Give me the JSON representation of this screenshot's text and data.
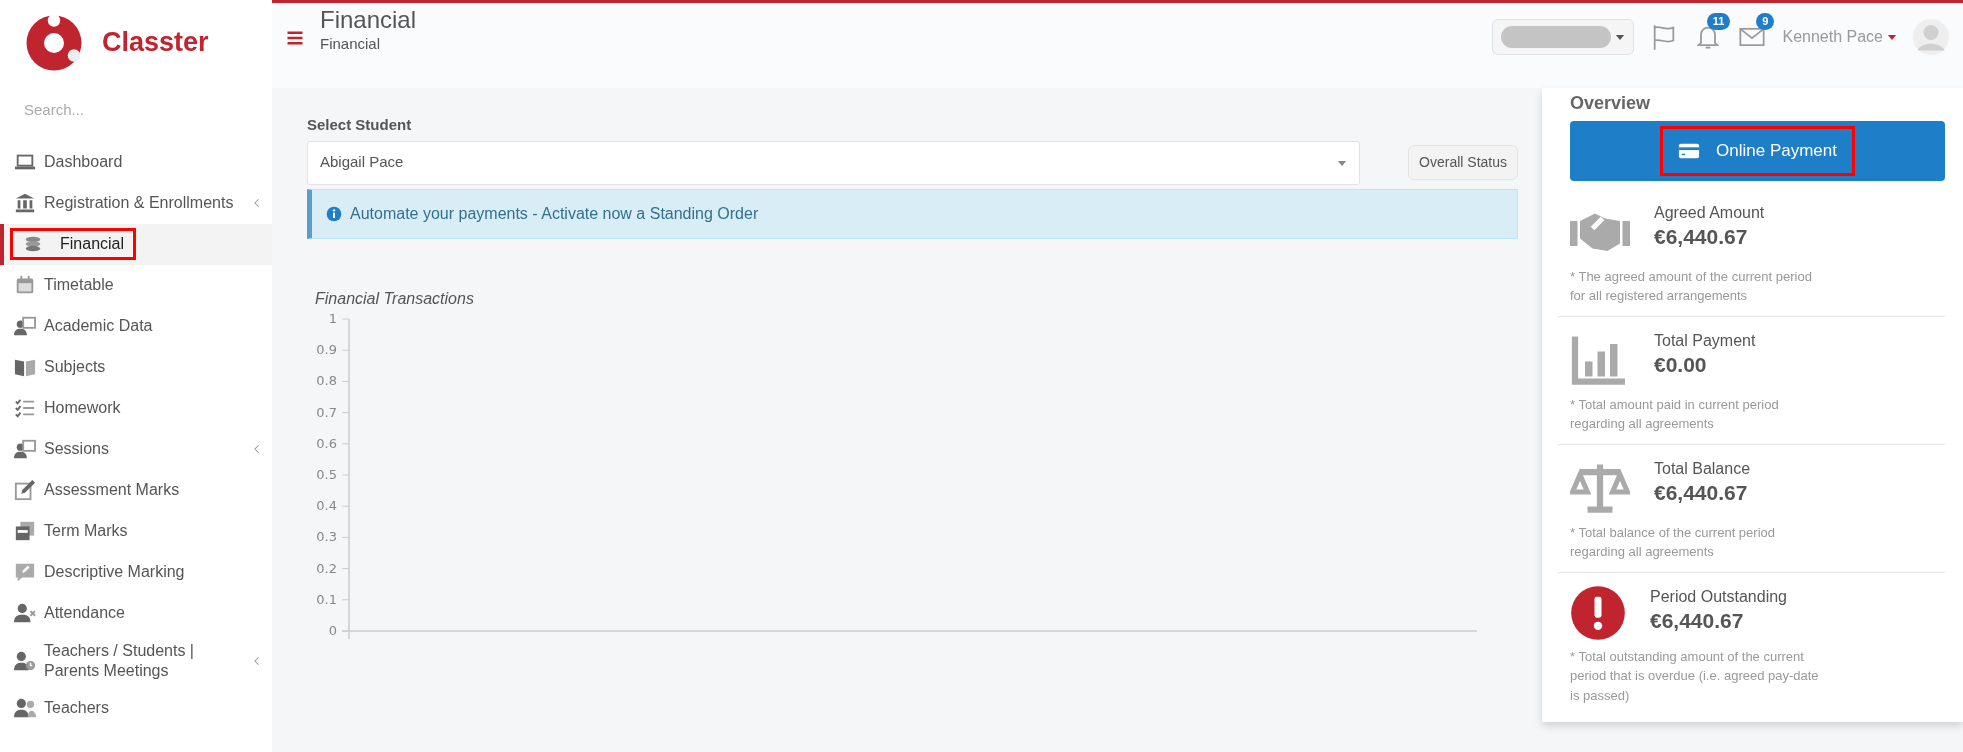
{
  "brand": {
    "name": "Classter"
  },
  "sidebar": {
    "search_placeholder": "Search...",
    "items": [
      {
        "label": "Dashboard",
        "selected": false,
        "has_submenu": false,
        "annotated": false
      },
      {
        "label": "Registration & Enrollments",
        "selected": false,
        "has_submenu": true,
        "annotated": false
      },
      {
        "label": "Financial",
        "selected": true,
        "has_submenu": false,
        "annotated": true
      },
      {
        "label": "Timetable",
        "selected": false,
        "has_submenu": false,
        "annotated": false
      },
      {
        "label": "Academic Data",
        "selected": false,
        "has_submenu": false,
        "annotated": false
      },
      {
        "label": "Subjects",
        "selected": false,
        "has_submenu": false,
        "annotated": false
      },
      {
        "label": "Homework",
        "selected": false,
        "has_submenu": false,
        "annotated": false
      },
      {
        "label": "Sessions",
        "selected": false,
        "has_submenu": true,
        "annotated": false
      },
      {
        "label": "Assessment Marks",
        "selected": false,
        "has_submenu": false,
        "annotated": false
      },
      {
        "label": "Term Marks",
        "selected": false,
        "has_submenu": false,
        "annotated": false
      },
      {
        "label": "Descriptive Marking",
        "selected": false,
        "has_submenu": false,
        "annotated": false
      },
      {
        "label": "Attendance",
        "selected": false,
        "has_submenu": false,
        "annotated": false
      },
      {
        "label": "Teachers / Students | Parents Meetings",
        "selected": false,
        "has_submenu": true,
        "annotated": false
      },
      {
        "label": "Teachers",
        "selected": false,
        "has_submenu": false,
        "annotated": false
      }
    ]
  },
  "header": {
    "title": "Financial",
    "subtitle": "Financial",
    "notifications_count": "11",
    "messages_count": "9",
    "user_name": "Kenneth Pace"
  },
  "main": {
    "select_label": "Select Student",
    "student": "Abigail Pace",
    "overall_status_button": "Overall Status",
    "alert": "Automate your payments - Activate now a Standing Order",
    "chart": {
      "title": "Financial Transactions",
      "y_axis_labels": [
        "1",
        "0.9",
        "0.8",
        "0.7",
        "0.6",
        "0.5",
        "0.4",
        "0.3",
        "0.2",
        "0.1",
        "0"
      ]
    }
  },
  "overview": {
    "title": "Overview",
    "payment_button": {
      "label": "Online Payment",
      "annotated": true
    },
    "stats": [
      {
        "label": "Agreed Amount",
        "amount": "€6,440.67",
        "note": "* The agreed amount of the current period for all registered arrangements"
      },
      {
        "label": "Total Payment",
        "amount": "€0.00",
        "note": "* Total amount paid in current period regarding all agreements"
      },
      {
        "label": "Total Balance",
        "amount": "€6,440.67",
        "note": "* Total balance of the current period regarding all agreements"
      },
      {
        "label": "Period Outstanding",
        "amount": "€6,440.67",
        "note": "* Total outstanding amount of the current period that is overdue (i.e. agreed pay-date is passed)"
      }
    ]
  }
}
